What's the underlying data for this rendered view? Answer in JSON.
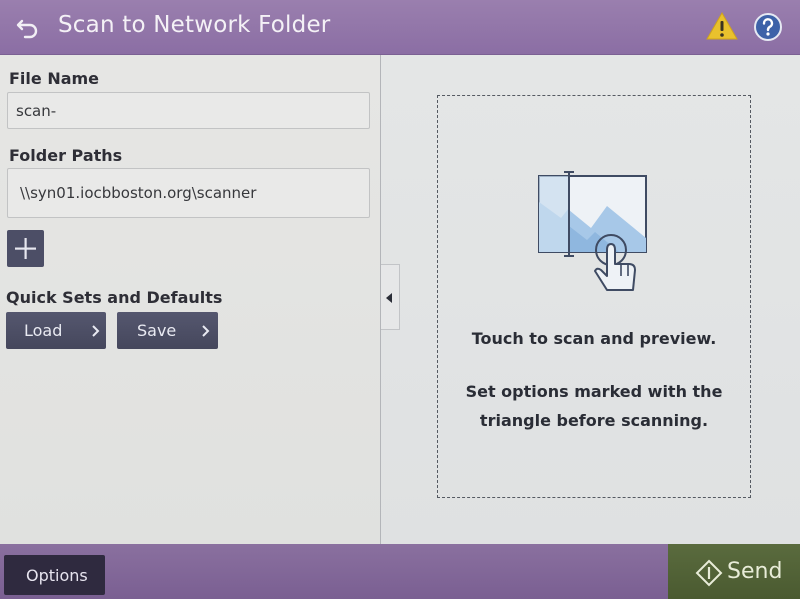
{
  "header": {
    "title": "Scan to Network Folder",
    "back_icon": "back-arrow-icon",
    "warning_icon": "warning-icon",
    "help_icon": "help-icon"
  },
  "file_name": {
    "label": "File Name",
    "value": "scan-"
  },
  "folder_paths": {
    "label": "Folder Paths",
    "value": "\\\\syn01.iocbboston.org\\scanner",
    "add_icon": "plus-icon"
  },
  "quick_sets": {
    "label": "Quick Sets and Defaults",
    "load_label": "Load",
    "save_label": "Save"
  },
  "preview": {
    "line1": "Touch to scan and preview.",
    "line2a": "Set options marked with the",
    "line2b": "triangle before scanning."
  },
  "footer": {
    "options_label": "Options",
    "send_label": "Send"
  },
  "colors": {
    "header": "#8b6ea4",
    "footer": "#7a5f92",
    "send": "#4f6035",
    "dark_button": "#4c4e66",
    "warning": "#e9c12d",
    "help": "#3d62a8",
    "illustration": "#a7c8e8"
  }
}
